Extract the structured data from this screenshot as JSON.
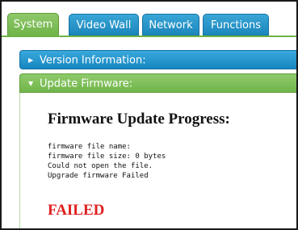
{
  "tabs": [
    {
      "label": "System",
      "active": true
    },
    {
      "label": "Video Wall",
      "active": false
    },
    {
      "label": "Network",
      "active": false
    },
    {
      "label": "Functions",
      "active": false
    }
  ],
  "panels": {
    "version": {
      "label": "Version Information:",
      "arrow_icon": "triangle-right-icon"
    },
    "update": {
      "label": "Update Firmware:",
      "arrow_icon": "triangle-down-icon"
    }
  },
  "update": {
    "title": "Firmware Update Progress:",
    "log_lines": [
      "firmware file name:",
      "firmware file size: 0 bytes",
      "Could not open the file.",
      "Upgrade firmware Failed"
    ],
    "result": "FAILED"
  },
  "colors": {
    "tab_active": "#6eb447",
    "tab_inactive": "#1a86bd",
    "panel_blue": "#1686c0",
    "panel_green": "#70b54a",
    "failed_text": "#e02020"
  }
}
